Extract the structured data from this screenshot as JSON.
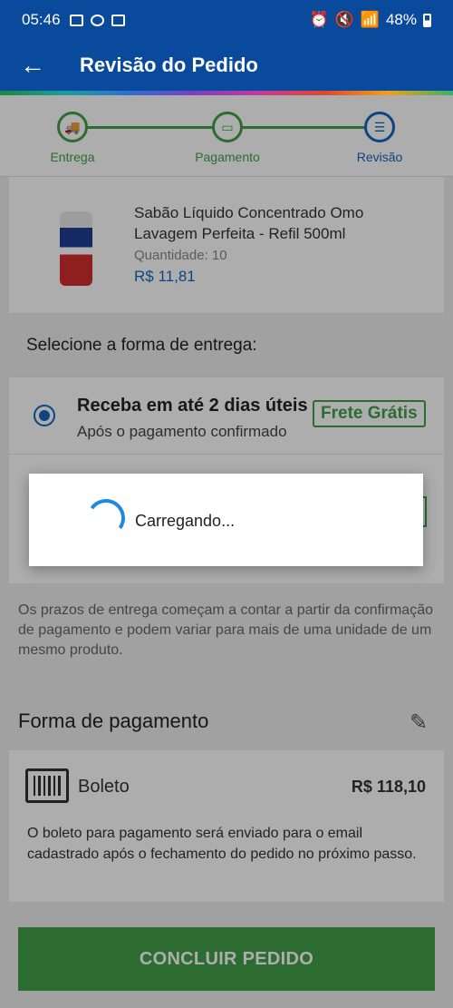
{
  "status_bar": {
    "time": "05:46",
    "battery": "48%"
  },
  "app_bar": {
    "title": "Revisão do Pedido"
  },
  "stepper": {
    "steps": [
      {
        "label": "Entrega",
        "icon": "truck-icon"
      },
      {
        "label": "Pagamento",
        "icon": "card-icon"
      },
      {
        "label": "Revisão",
        "icon": "receipt-icon"
      }
    ]
  },
  "product": {
    "name": "Sabão Líquido Concentrado Omo Lavagem Perfeita - Refil 500ml",
    "quantity": "Quantidade:  10",
    "price": "R$ 11,81"
  },
  "shipping": {
    "heading": "Selecione a forma de entrega:",
    "option1": {
      "title": "Receba em até 2 dias úteis",
      "subtitle": "Após o pagamento confirmado",
      "badge": "Frete Grátis"
    },
    "note": "Os prazos de entrega começam a contar a partir da confirmação de pagamento e podem variar para mais de uma unidade de um mesmo produto."
  },
  "payment": {
    "heading": "Forma de pagamento",
    "method": "Boleto",
    "total": "R$ 118,10",
    "description": "O boleto para pagamento será enviado para o email cadastrado após o fechamento do pedido no próximo passo."
  },
  "cta": {
    "label": "CONCLUIR PEDIDO"
  },
  "loading_dialog": {
    "message": "Carregando..."
  },
  "colors": {
    "primary": "#0a4a9c",
    "success": "#43a047",
    "accent": "#1565c0"
  }
}
